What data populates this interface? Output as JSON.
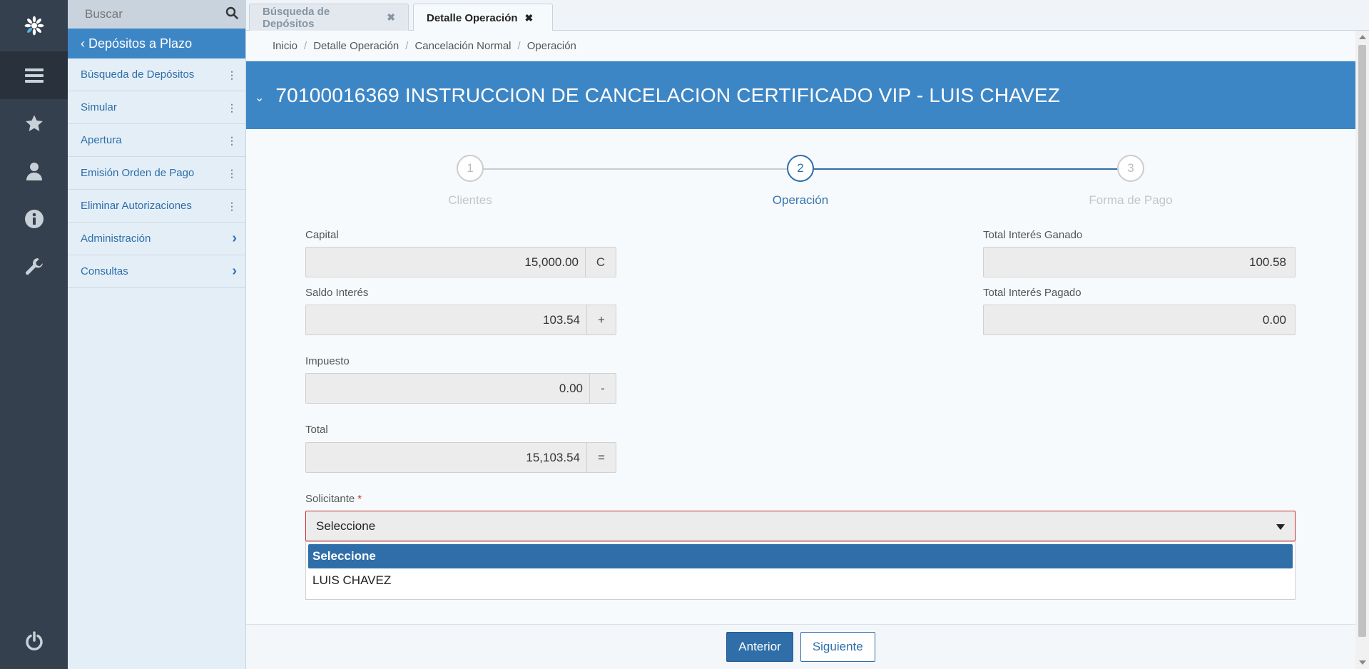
{
  "sidebar": {
    "search_placeholder": "Buscar",
    "module_label": "‹ Depósitos a Plazo",
    "items": [
      {
        "label": "Búsqueda de Depósitos",
        "icon": "kebab-icon"
      },
      {
        "label": "Simular",
        "icon": "kebab-icon"
      },
      {
        "label": "Apertura",
        "icon": "kebab-icon"
      },
      {
        "label": "Emisión Orden de Pago",
        "icon": "kebab-icon"
      },
      {
        "label": "Eliminar Autorizaciones",
        "icon": "kebab-icon"
      },
      {
        "label": "Administración",
        "icon": "chevron-right-icon"
      },
      {
        "label": "Consultas",
        "icon": "chevron-right-icon"
      }
    ]
  },
  "rail": {
    "icons": [
      "logo-icon",
      "menu-icon",
      "star-icon",
      "user-icon",
      "info-icon",
      "wrench-icon",
      "power-icon"
    ]
  },
  "tabs": [
    {
      "label": "Búsqueda de Depósitos",
      "active": false
    },
    {
      "label": "Detalle Operación",
      "active": true
    }
  ],
  "breadcrumb": [
    "Inicio",
    "Detalle Operación",
    "Cancelación Normal",
    "Operación"
  ],
  "header": {
    "title": "70100016369  INSTRUCCION DE CANCELACION CERTIFICADO VIP -  LUIS CHAVEZ"
  },
  "stepper": {
    "steps": [
      {
        "number": "1",
        "label": "Clientes"
      },
      {
        "number": "2",
        "label": "Operación"
      },
      {
        "number": "3",
        "label": "Forma de Pago"
      }
    ],
    "current": 2
  },
  "form": {
    "capital": {
      "label": "Capital",
      "value": "15,000.00",
      "addon": "C"
    },
    "saldo_interes": {
      "label": "Saldo Interés",
      "value": "103.54",
      "addon": "+"
    },
    "impuesto": {
      "label": "Impuesto",
      "value": "0.00",
      "addon": "-"
    },
    "total": {
      "label": "Total",
      "value": "15,103.54",
      "addon": "="
    },
    "total_interes_ganado": {
      "label": "Total Interés Ganado",
      "value": "100.58"
    },
    "total_interes_pagado": {
      "label": "Total Interés Pagado",
      "value": "0.00"
    },
    "solicitante": {
      "label": "Solicitante",
      "required_mark": "*",
      "value": "Seleccione",
      "options": [
        "Seleccione",
        "LUIS CHAVEZ"
      ]
    }
  },
  "footer": {
    "prev_label": "Anterior",
    "next_label": "Siguiente"
  },
  "colors": {
    "accent": "#3d86c6",
    "primary_button": "#2f6ea8",
    "rail": "#35404e",
    "error_border": "#c9302c"
  }
}
